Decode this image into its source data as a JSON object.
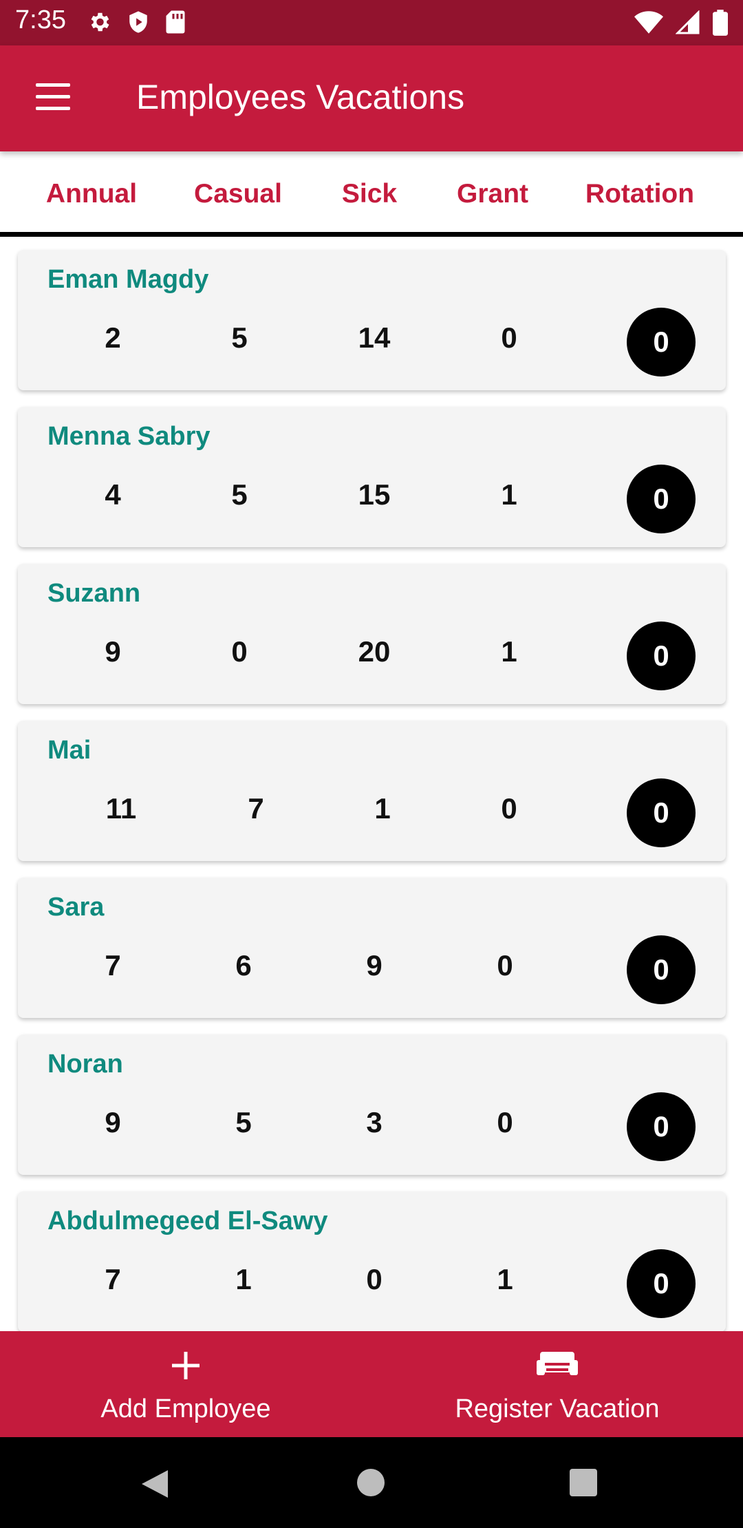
{
  "status_bar": {
    "time": "7:35",
    "left_icons": [
      "gear-icon",
      "shield-icon",
      "sd-card-icon"
    ],
    "right_icons": [
      "wifi-icon",
      "signal-icon",
      "battery-icon"
    ]
  },
  "app_bar": {
    "title": "Employees Vacations",
    "menu_icon": "menu-icon",
    "color": "#c41b3d"
  },
  "tabs": [
    {
      "label": "Annual"
    },
    {
      "label": "Casual"
    },
    {
      "label": "Sick"
    },
    {
      "label": "Grant"
    },
    {
      "label": "Rotation"
    }
  ],
  "employees": [
    {
      "name": "Eman Magdy",
      "annual": "2",
      "casual": "5",
      "sick": "14",
      "grant": "0",
      "rotation": "0"
    },
    {
      "name": "Menna Sabry",
      "annual": "4",
      "casual": "5",
      "sick": "15",
      "grant": "1",
      "rotation": "0"
    },
    {
      "name": "Suzann",
      "annual": "9",
      "casual": "0",
      "sick": "20",
      "grant": "1",
      "rotation": "0"
    },
    {
      "name": "Mai",
      "annual": "11",
      "casual": "7",
      "sick": "1",
      "grant": "0",
      "rotation": "0"
    },
    {
      "name": "Sara",
      "annual": "7",
      "casual": "6",
      "sick": "9",
      "grant": "0",
      "rotation": "0"
    },
    {
      "name": "Noran",
      "annual": "9",
      "casual": "5",
      "sick": "3",
      "grant": "0",
      "rotation": "0"
    },
    {
      "name": "Abdulmegeed El-Sawy",
      "annual": "7",
      "casual": "1",
      "sick": "0",
      "grant": "1",
      "rotation": "0"
    }
  ],
  "bottom_actions": [
    {
      "label": "Add Employee",
      "icon": "plus-icon"
    },
    {
      "label": "Register Vacation",
      "icon": "sofa-icon"
    }
  ],
  "nav_bar": {
    "icons": [
      "back-icon",
      "home-icon",
      "recents-icon"
    ]
  },
  "colors": {
    "status_bar": "#92132e",
    "accent": "#c41b3d",
    "name_text": "#0f8a7e",
    "card_bg": "#f4f4f4"
  }
}
